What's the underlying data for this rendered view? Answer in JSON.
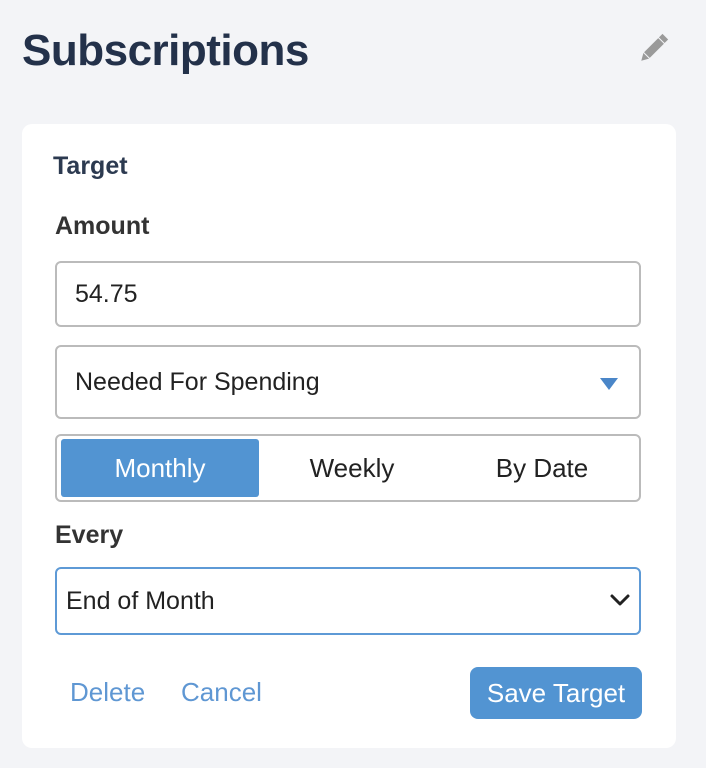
{
  "header": {
    "title": "Subscriptions",
    "edit_icon": "pencil-icon"
  },
  "target": {
    "section_label": "Target",
    "amount_label": "Amount",
    "amount_value": "54.75",
    "type_select": {
      "selected": "Needed For Spending",
      "icon": "triangle-down-icon"
    },
    "frequency_tabs": [
      {
        "label": "Monthly",
        "active": true
      },
      {
        "label": "Weekly",
        "active": false
      },
      {
        "label": "By Date",
        "active": false
      }
    ],
    "every_label": "Every",
    "every_select": {
      "selected": "End of Month",
      "icon": "chevron-down-icon"
    }
  },
  "actions": {
    "delete_label": "Delete",
    "cancel_label": "Cancel",
    "save_label": "Save Target"
  },
  "colors": {
    "accent": "#5294d2",
    "title": "#23314a",
    "link": "#5f97d3",
    "background": "#f3f4f7",
    "card": "#ffffff"
  }
}
